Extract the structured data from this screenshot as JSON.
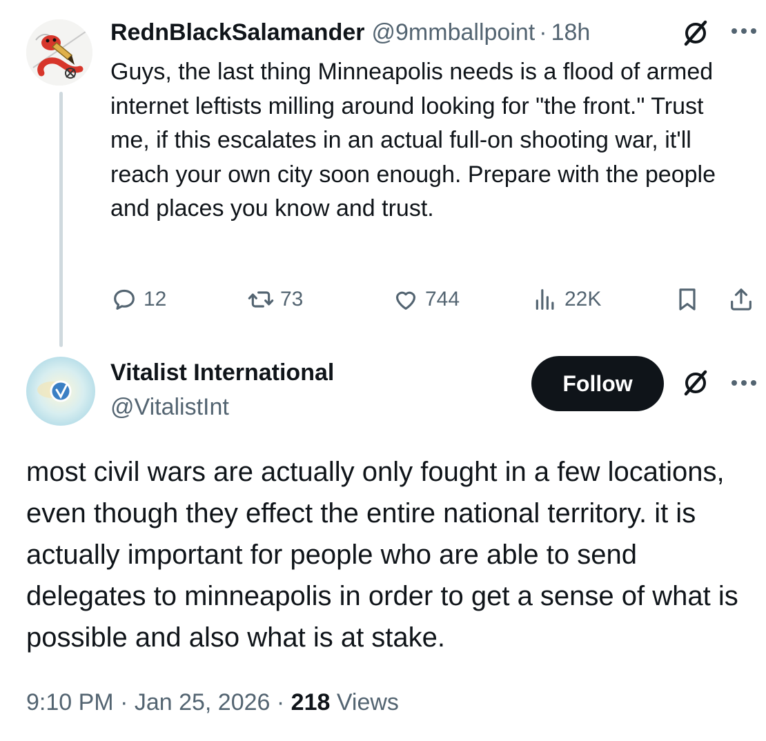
{
  "parent": {
    "display_name": "RednBlackSalamander",
    "handle": "@9mmballpoint",
    "separator": "·",
    "time": "18h",
    "text": "Guys, the last thing Minneapolis needs is a flood of armed internet leftists milling around looking for \"the front.\" Trust me, if this escalates in an actual full-on shooting war, it'll reach your own city soon enough. Prepare with the people and places you know and trust.",
    "actions": {
      "replies": "12",
      "reposts": "73",
      "likes": "744",
      "views": "22K"
    }
  },
  "main": {
    "display_name": "Vitalist International",
    "handle": "@VitalistInt",
    "follow_label": "Follow",
    "text": "most civil wars are actually only fought in a few locations, even though they effect the entire national territory. it is actually important for people who are able to send delegates to minneapolis in order to get a sense of what is possible and also what is at stake.",
    "timestamp": "9:10 PM · Jan 25, 2026 · ",
    "views_count": "218",
    "views_label": " Views"
  },
  "colors": {
    "text_primary": "#0f1419",
    "text_secondary": "#536471",
    "thread_line": "#cfd9de",
    "follow_bg": "#0f1419",
    "salamander_red": "#d7362b"
  },
  "icons": [
    "grok-icon",
    "more-icon",
    "reply-icon",
    "repost-icon",
    "like-icon",
    "views-icon",
    "bookmark-icon",
    "share-icon"
  ]
}
